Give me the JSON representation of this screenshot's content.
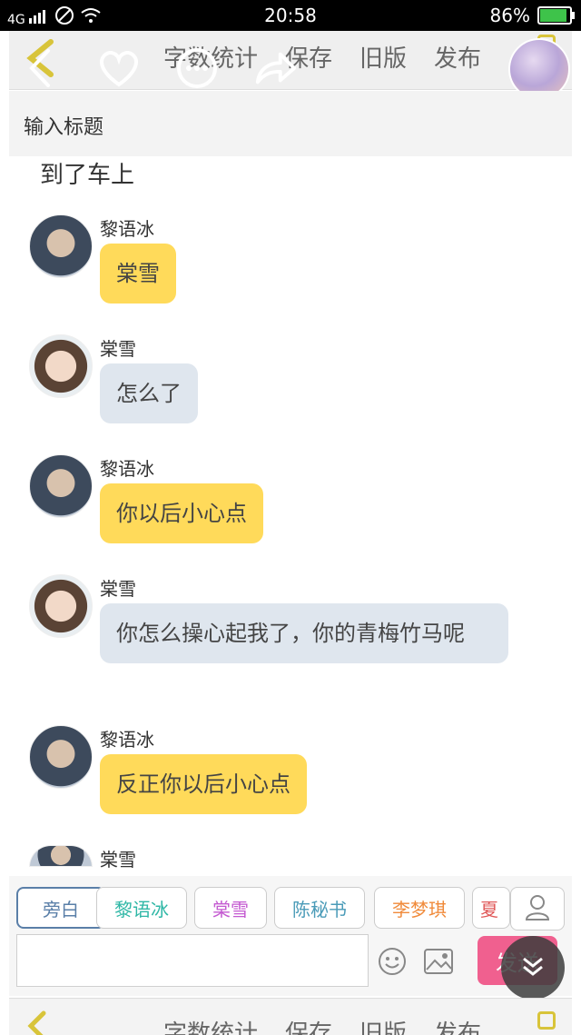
{
  "status": {
    "time": "20:58",
    "battery": "86%",
    "battery_level": 0.86,
    "network": "4G"
  },
  "toolbar": {
    "menu": [
      "字数统计",
      "保存",
      "旧版",
      "发布"
    ]
  },
  "title_placeholder": "输入标题",
  "intro_text": "到了车上",
  "messages": [
    {
      "name": "黎语冰",
      "text": "棠雪"
    },
    {
      "name": "棠雪",
      "text": "怎么了"
    },
    {
      "name": "黎语冰",
      "text": "你以后小心点"
    },
    {
      "name": "棠雪",
      "text": "你怎么操心起我了，你的青梅竹马呢"
    },
    {
      "name": "黎语冰",
      "text": "反正你以后小心点"
    },
    {
      "name": "棠雪",
      "text": ""
    }
  ],
  "characters": [
    "旁白",
    "黎语冰",
    "棠雪",
    "陈秘书",
    "李梦琪",
    "夏"
  ],
  "character_colors": {
    "旁白": "#5a7fa8",
    "黎语冰": "#2fb7a6",
    "棠雪": "#c45ad1",
    "陈秘书": "#4a9bb8",
    "李梦琪": "#f08a3a",
    "夏": "#e05a5a"
  },
  "send_label": "发送",
  "bottom_menu": [
    "字数统计",
    "保存",
    "旧版",
    "发布"
  ],
  "colors": {
    "accent_yellow": "#ffda5a",
    "bubble_gray": "#dfe6ee",
    "send_pink": "#f0608f"
  }
}
